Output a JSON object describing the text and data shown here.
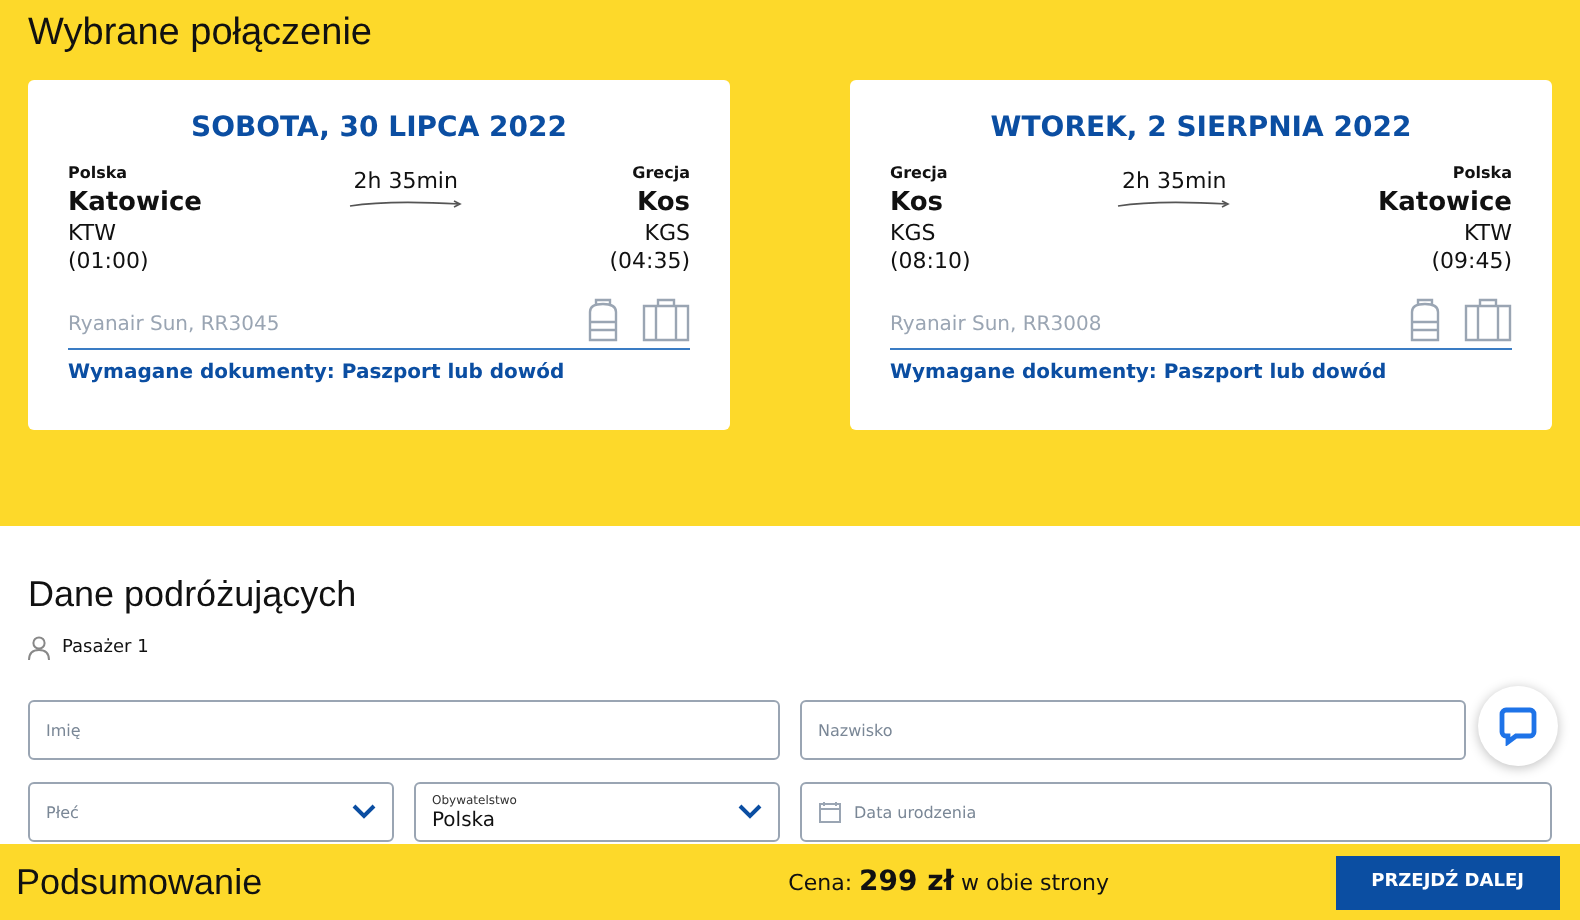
{
  "selected_connection": {
    "title": "Wybrane połączenie",
    "flights": [
      {
        "date": "SOBOTA, 30 LIPCA 2022",
        "from": {
          "country": "Polska",
          "city": "Katowice",
          "code": "KTW",
          "time": "(01:00)"
        },
        "duration": "2h 35min",
        "to": {
          "country": "Grecja",
          "city": "Kos",
          "code": "KGS",
          "time": "(04:35)"
        },
        "carrier": "Ryanair Sun, RR3045",
        "documents": "Wymagane dokumenty: Paszport lub dowód"
      },
      {
        "date": "WTOREK, 2 SIERPNIA 2022",
        "from": {
          "country": "Grecja",
          "city": "Kos",
          "code": "KGS",
          "time": "(08:10)"
        },
        "duration": "2h 35min",
        "to": {
          "country": "Polska",
          "city": "Katowice",
          "code": "KTW",
          "time": "(09:45)"
        },
        "carrier": "Ryanair Sun, RR3008",
        "documents": "Wymagane dokumenty: Paszport lub dowód"
      }
    ]
  },
  "travellers": {
    "title": "Dane podróżujących",
    "passenger": "Pasażer 1",
    "fields": [
      {
        "kind": "text",
        "placeholder": "Imię"
      },
      {
        "kind": "text",
        "placeholder": "Nazwisko"
      },
      {
        "kind": "select",
        "placeholder": "Płeć"
      },
      {
        "kind": "select",
        "label": "Obywatelstwo",
        "value": "Polska"
      },
      {
        "kind": "date",
        "placeholder": "Data urodzenia"
      }
    ]
  },
  "summary": {
    "title": "Podsumowanie",
    "price": "Cena: **299 zł** w obie strony",
    "button": "PRZEJDŹ DALEJ"
  }
}
